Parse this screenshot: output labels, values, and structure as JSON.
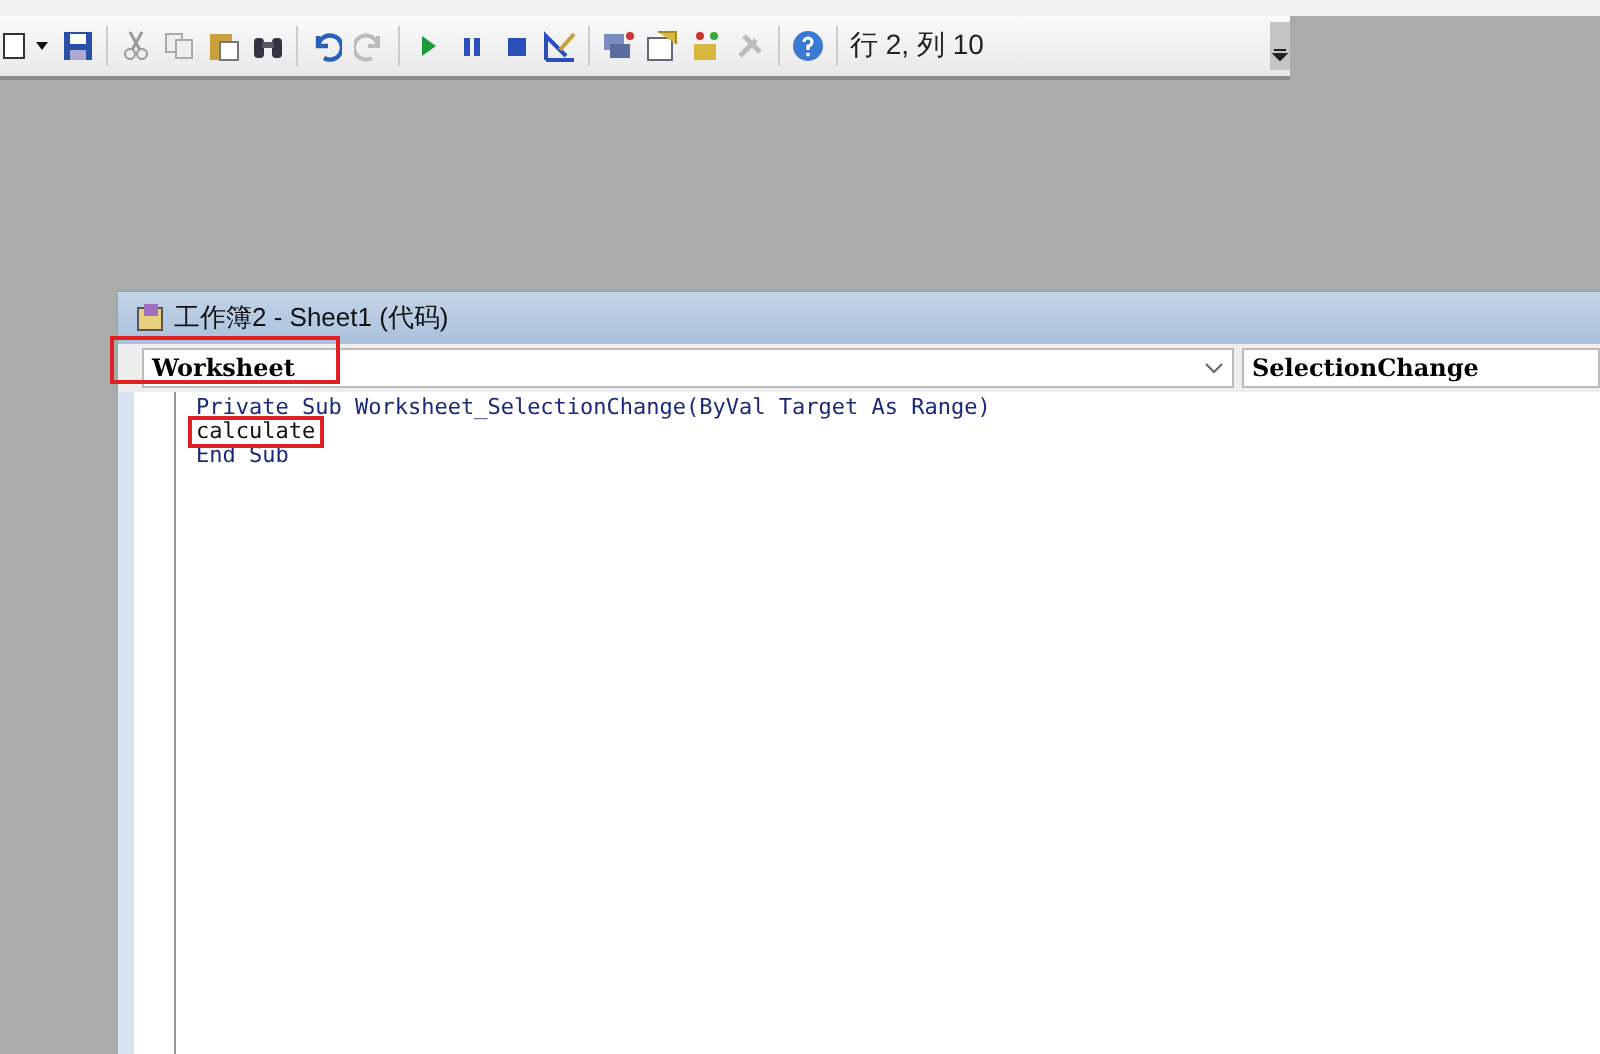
{
  "toolbar": {
    "position": "行 2, 列 10"
  },
  "code_window": {
    "title": "工作簿2 - Sheet1 (代码)",
    "object_dropdown": {
      "value": "Worksheet",
      "highlighted": true
    },
    "procedure_dropdown": {
      "value": "SelectionChange"
    },
    "lines": [
      {
        "text": "Private Sub Worksheet_SelectionChange(ByVal Target As Range)",
        "kind": "keyword",
        "highlighted": false
      },
      {
        "text": "calculate",
        "kind": "plain",
        "highlighted": true
      },
      {
        "text": "End Sub",
        "kind": "keyword",
        "highlighted": false
      }
    ]
  }
}
